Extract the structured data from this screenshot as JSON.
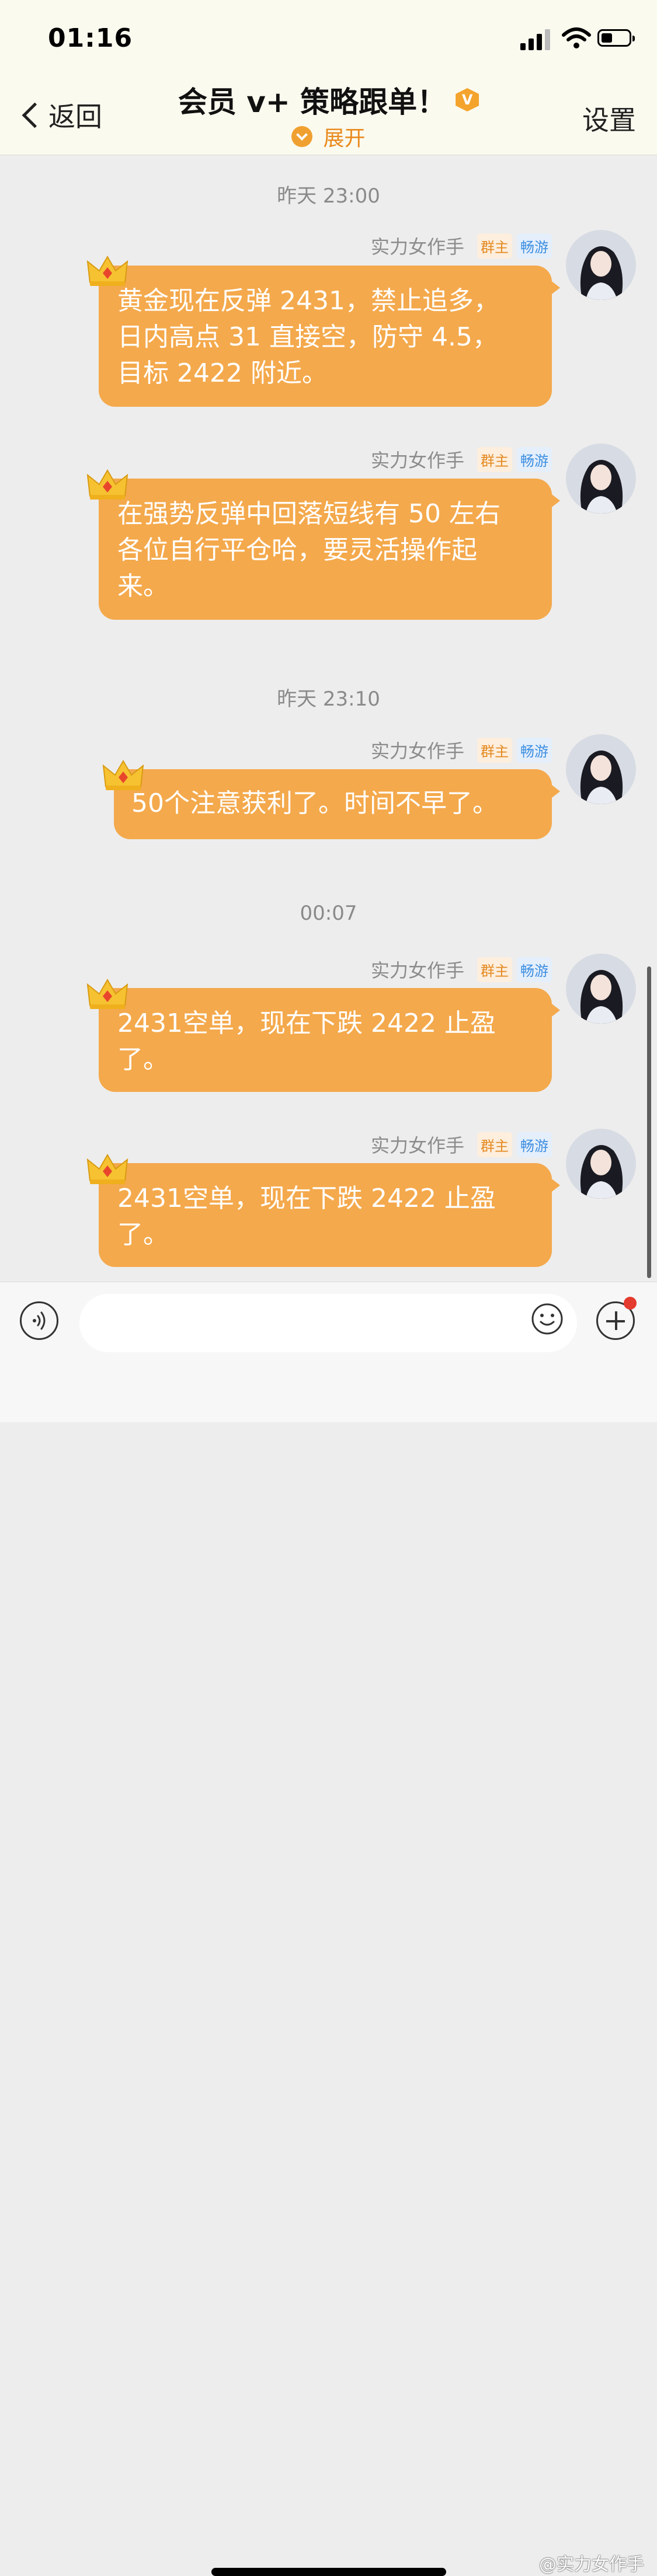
{
  "status_bar": {
    "time": "01:16"
  },
  "header": {
    "back_label": "返回",
    "title": "会员 v+ 策略跟单！",
    "vip_badge": "V",
    "expand_label": "展开",
    "settings_label": "设置"
  },
  "chat": {
    "timestamps": [
      "昨天 23:00",
      "昨天 23:10",
      "00:07"
    ],
    "messages": [
      {
        "sender": "实力女作手",
        "tag_owner": "群主",
        "tag_level": "畅游",
        "lines": [
          "黄金现在反弹 2431，禁止追多，",
          "日内高点 31 直接空，防守 4.5，",
          "目标 2422 附近。"
        ]
      },
      {
        "sender": "实力女作手",
        "tag_owner": "群主",
        "tag_level": "畅游",
        "lines": [
          "在强势反弹中回落短线有 50 左右",
          "各位自行平仓哈，要灵活操作起",
          "来。"
        ]
      },
      {
        "sender": "实力女作手",
        "tag_owner": "群主",
        "tag_level": "畅游",
        "lines": [
          "50个注意获利了。时间不早了。"
        ]
      },
      {
        "sender": "实力女作手",
        "tag_owner": "群主",
        "tag_level": "畅游",
        "lines": [
          "2431空单，现在下跌 2422 止盈",
          "了。"
        ]
      },
      {
        "sender": "实力女作手",
        "tag_owner": "群主",
        "tag_level": "畅游",
        "lines": [
          "2431空单，现在下跌 2422 止盈",
          "了。"
        ]
      }
    ]
  },
  "input_bar": {
    "placeholder": ""
  },
  "watermark": "@实力女作手",
  "colors": {
    "bubble": "#f4a94c",
    "accent": "#f0a030",
    "header_bg": "#fbfaef",
    "background": "#ededed"
  }
}
